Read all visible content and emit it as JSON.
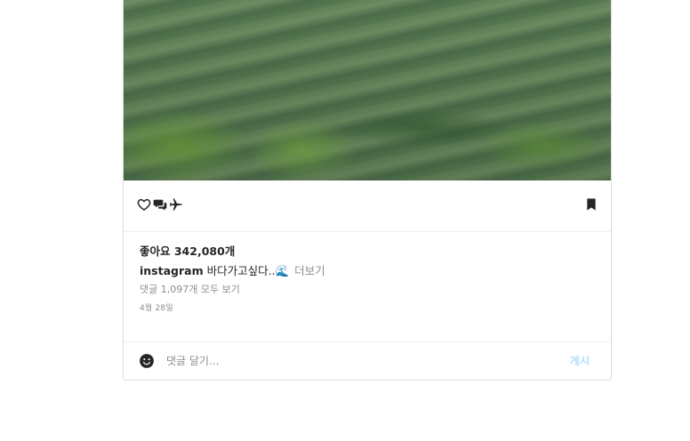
{
  "post": {
    "likes_text": "좋아요 342,080개",
    "caption": {
      "username": "instagram",
      "text": " 바다가고싶다..",
      "emoji": "🌊",
      "more_label": "더보기"
    },
    "view_comments_text": "댓글 1,097개 모두 보기",
    "date_text": "4월 28일"
  },
  "actions": {
    "icons": [
      "heart-icon",
      "comment-icon",
      "share-icon",
      "bookmark-icon"
    ]
  },
  "comment_bar": {
    "emoji_icon": "smiley-icon",
    "placeholder": "댓글 달기...",
    "post_label": "게시",
    "post_color": "#b2dffc"
  }
}
